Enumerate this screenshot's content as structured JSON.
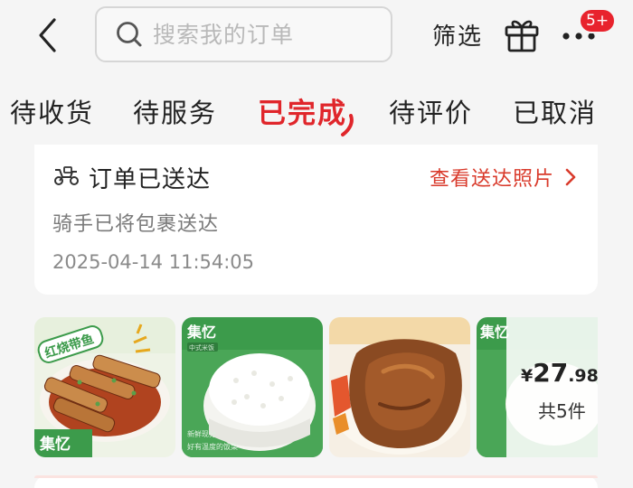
{
  "header": {
    "search_placeholder": "搜索我的订单",
    "filter_label": "筛选",
    "notification_badge": "5+"
  },
  "tabs": [
    {
      "label": "待收货",
      "active": false
    },
    {
      "label": "待服务",
      "active": false
    },
    {
      "label": "已完成",
      "active": true
    },
    {
      "label": "待评价",
      "active": false
    },
    {
      "label": "已取消",
      "active": false
    }
  ],
  "order": {
    "status_title": "订单已送达",
    "view_photo_label": "查看送达照片",
    "status_detail": "骑手已将包裹送达",
    "timestamp": "2025-04-14 11:54:05",
    "products": [
      {
        "name": "红烧带鱼",
        "brand": "集忆"
      },
      {
        "name": "米饭",
        "brand": "集忆",
        "tag": "中式米饭",
        "slogan": "新鲜现分 好有温度的饭菜"
      },
      {
        "name": "红烧肉排"
      },
      {
        "name": "",
        "brand": "集忆"
      }
    ],
    "price": {
      "currency": "¥",
      "integer": "27",
      "decimal": ".98"
    },
    "count_label": "共5件"
  },
  "colors": {
    "accent": "#e0262b",
    "link": "#d93a2b",
    "background": "#f5f5f5",
    "card": "#ffffff",
    "brand_green": "#3c9b4b"
  }
}
